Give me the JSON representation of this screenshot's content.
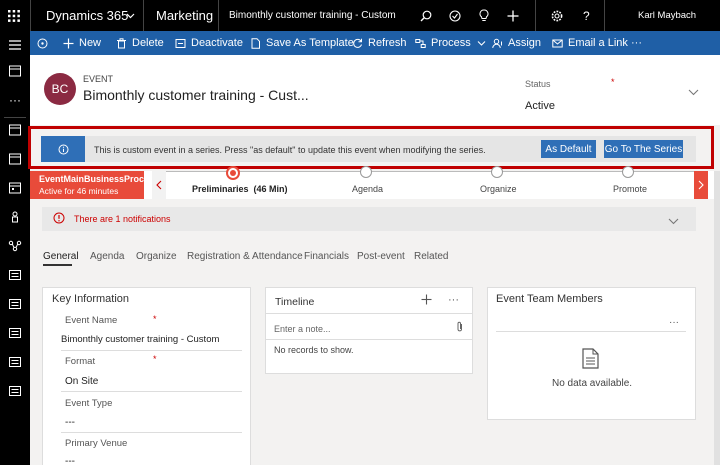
{
  "topbar": {
    "app_name": "Dynamics 365",
    "module": "Marketing",
    "record_title": "Bimonthly customer training - Custom",
    "user_name": "Karl Maybach"
  },
  "commands": {
    "new": "New",
    "delete": "Delete",
    "deactivate": "Deactivate",
    "save_as_template": "Save As Template",
    "refresh": "Refresh",
    "process": "Process",
    "assign": "Assign",
    "email_link": "Email a Link",
    "more": "···"
  },
  "header": {
    "avatar_initials": "BC",
    "entity_type": "EVENT",
    "title": "Bimonthly customer training - Cust...",
    "status_label": "Status",
    "status_value": "Active"
  },
  "banner": {
    "message": "This is custom event in a series. Press \"as default\" to update this event when modifying the series.",
    "as_default_label": "As Default",
    "go_series_label": "Go To The Series"
  },
  "process": {
    "active_process": "EventMainBusinessProce...",
    "active_duration": "Active for 46 minutes",
    "stages": [
      {
        "label": "Preliminaries  (46 Min)"
      },
      {
        "label": "Agenda"
      },
      {
        "label": "Organize"
      },
      {
        "label": "Promote"
      }
    ]
  },
  "notifications": {
    "text": "There are 1 notifications"
  },
  "tabs": [
    "General",
    "Agenda",
    "Organize",
    "Registration & Attendance",
    "Financials",
    "Post-event",
    "Related"
  ],
  "key_info": {
    "title": "Key Information",
    "fields": [
      {
        "label": "Event Name",
        "value": "Bimonthly customer training - Custom"
      },
      {
        "label": "Format",
        "value": "On Site"
      },
      {
        "label": "Event Type",
        "value": "---"
      },
      {
        "label": "Primary Venue",
        "value": "---"
      }
    ]
  },
  "timeline": {
    "title": "Timeline",
    "note_placeholder": "Enter a note...",
    "empty_text": "No records to show."
  },
  "team": {
    "title": "Event Team Members",
    "empty_text": "No data available.",
    "more": "···"
  },
  "colors": {
    "topbar": "#000000",
    "commandbar": "#1f5fa6",
    "accent_red": "#c00000",
    "stage_active": "#e84b3a",
    "button_blue": "#2f6fb7",
    "avatar": "#8b2a42"
  }
}
